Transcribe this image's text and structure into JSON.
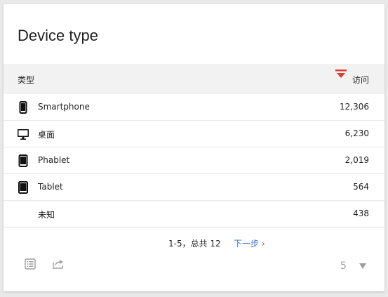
{
  "widget": {
    "title": "Device type",
    "columns": {
      "type": "类型",
      "visits": "访问"
    },
    "sort": {
      "column": "visits",
      "direction": "desc",
      "indicator_color": "#e53935"
    },
    "rows": [
      {
        "icon": "smartphone-icon",
        "label": "Smartphone",
        "visits": "12,306"
      },
      {
        "icon": "desktop-icon",
        "label": "桌面",
        "visits": "6,230"
      },
      {
        "icon": "phablet-icon",
        "label": "Phablet",
        "visits": "2,019"
      },
      {
        "icon": "tablet-icon",
        "label": "Tablet",
        "visits": "564"
      },
      {
        "icon": "",
        "label": "未知",
        "visits": "438"
      }
    ],
    "pagination": {
      "info": "1-5，总共 12",
      "next_label": "下一步 ›",
      "page_size": "5"
    },
    "footer_icons": [
      "visualization-table-icon",
      "export-icon"
    ],
    "colors": {
      "link": "#3c73c7",
      "header_bg": "#f2f2f2"
    }
  }
}
